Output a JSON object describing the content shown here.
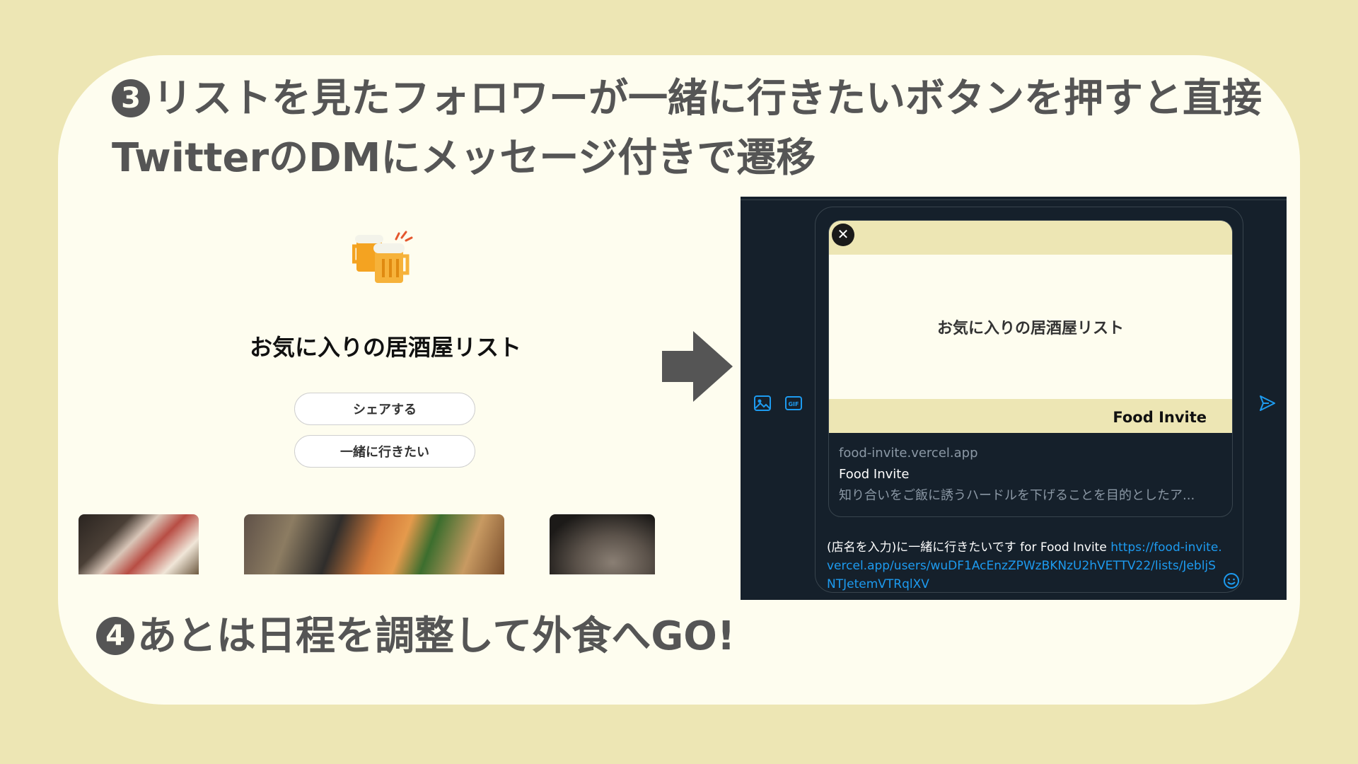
{
  "step3": {
    "number": "3",
    "line1": "リストを見たフォロワーが一緒に行きたいボタンを押すと直接",
    "line2": "TwitterのDMにメッセージ付きで遷移"
  },
  "step4": {
    "number": "4",
    "text": "あとは日程を調整して外食へGO!"
  },
  "list_page": {
    "title": "お気に入りの居酒屋リスト",
    "share_label": "シェアする",
    "together_label": "一緒に行きたい"
  },
  "dm": {
    "card": {
      "preview_title": "お気に入りの居酒屋リスト",
      "preview_brand": "Food Invite",
      "close_symbol": "✕",
      "domain": "food-invite.vercel.app",
      "name": "Food Invite",
      "description": "知り合いをご飯に誘うハードルを下げることを目的としたア..."
    },
    "message": {
      "text": "(店名を入力)に一緒に行きたいです for Food Invite ",
      "link": "https://food-invite.vercel.app/users/wuDF1AcEnzZPWzBKNzU2hVETTV22/lists/JebljSNTJetemVTRqlXV"
    },
    "icons": [
      "image-icon",
      "gif-icon",
      "send-icon",
      "emoji-icon",
      "close-icon"
    ]
  },
  "colors": {
    "background": "#EDE6B4",
    "card": "#FEFDEF",
    "dm_background": "#15202B",
    "link": "#1D9BF0",
    "heading": "#555555"
  }
}
